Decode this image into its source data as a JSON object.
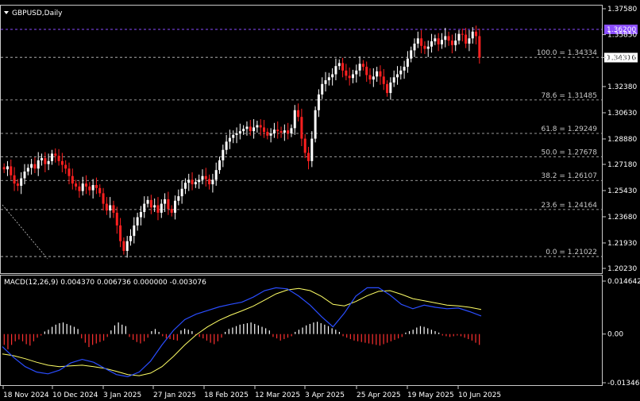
{
  "window": {
    "title": "GBPUSD,Daily",
    "menu_icon": "triangle-down-icon"
  },
  "colors": {
    "background": "#000000",
    "bull": "#ffffff",
    "bear": "#ff2020",
    "fib_line": "#c8c8c8",
    "resistance_line": "#8a4dff",
    "resistance_label_bg": "#8a4dff",
    "macd_line": "#2a4dff",
    "signal_line": "#ffff66",
    "hist_pos": "#ffffff",
    "hist_neg": "#ff3030"
  },
  "chart_data": [
    {
      "type": "candlestick",
      "title": "GBPUSD,Daily",
      "ylim": [
        1.2023,
        1.3758
      ],
      "y_ticks": [
        "1.37580",
        "1.35850",
        "1.34316",
        "1.32380",
        "1.30630",
        "1.28880",
        "1.27180",
        "1.25430",
        "1.23680",
        "1.21930",
        "1.20230"
      ],
      "x_ticks": [
        "18 Nov 2024",
        "10 Dec 2024",
        "3 Jan 2025",
        "27 Jan 2025",
        "18 Feb 2025",
        "12 Mar 2025",
        "3 Apr 2025",
        "25 Apr 2025",
        "19 May 2025",
        "10 Jun 2025"
      ],
      "current_price": "1.34316",
      "resistance": {
        "value": 1.362,
        "label": "1.36200"
      },
      "fib_levels": [
        {
          "value": 1.34334,
          "label": "100.0 = 1.34334"
        },
        {
          "value": 1.31485,
          "label": "78.6 = 1.31485"
        },
        {
          "value": 1.29249,
          "label": "61.8 = 1.29249"
        },
        {
          "value": 1.27678,
          "label": "50.0 = 1.27678"
        },
        {
          "value": 1.26107,
          "label": "38.2 = 1.26107"
        },
        {
          "value": 1.24164,
          "label": "23.6 = 1.24164"
        },
        {
          "value": 1.21022,
          "label": "0.0 = 1.21022"
        }
      ],
      "closes": [
        1.2685,
        1.2705,
        1.2645,
        1.259,
        1.2575,
        1.2625,
        1.267,
        1.2695,
        1.272,
        1.269,
        1.2745,
        1.276,
        1.272,
        1.274,
        1.279,
        1.2775,
        1.274,
        1.2715,
        1.269,
        1.264,
        1.259,
        1.257,
        1.254,
        1.259,
        1.257,
        1.2545,
        1.258,
        1.256,
        1.2525,
        1.2455,
        1.241,
        1.2445,
        1.2395,
        1.231,
        1.2205,
        1.214,
        1.2205,
        1.224,
        1.231,
        1.2365,
        1.24,
        1.2455,
        1.248,
        1.243,
        1.2445,
        1.2395,
        1.2455,
        1.2485,
        1.242,
        1.2395,
        1.2475,
        1.2505,
        1.2555,
        1.2595,
        1.2615,
        1.2585,
        1.26,
        1.2615,
        1.264,
        1.262,
        1.2585,
        1.2615,
        1.268,
        1.2745,
        1.2815,
        1.287,
        1.2895,
        1.2915,
        1.2925,
        1.294,
        1.2955,
        1.297,
        1.294,
        1.2965,
        1.298,
        1.2965,
        1.2935,
        1.291,
        1.2925,
        1.295,
        1.294,
        1.293,
        1.2945,
        1.2925,
        1.296,
        1.308,
        1.3035,
        1.289,
        1.2795,
        1.274,
        1.289,
        1.308,
        1.3185,
        1.3255,
        1.328,
        1.33,
        1.332,
        1.3375,
        1.3395,
        1.3345,
        1.331,
        1.3295,
        1.332,
        1.3345,
        1.339,
        1.337,
        1.3315,
        1.3285,
        1.3305,
        1.334,
        1.3305,
        1.3255,
        1.3195,
        1.3265,
        1.33,
        1.332,
        1.3345,
        1.337,
        1.3425,
        1.348,
        1.3525,
        1.356,
        1.351,
        1.349,
        1.3505,
        1.354,
        1.356,
        1.352,
        1.355,
        1.3575,
        1.3545,
        1.3515,
        1.3545,
        1.359,
        1.3585,
        1.3525,
        1.356,
        1.3605,
        1.3575,
        1.3431
      ],
      "last_close": 1.34316
    },
    {
      "type": "line",
      "title": "MACD(12,26,9) 0.004370 0.006736 0.000000 -0.003076",
      "ylim": [
        -0.013461,
        0.014642
      ],
      "y_ticks": [
        "0.014642",
        "0.00",
        "-0.013461"
      ],
      "series": [
        {
          "name": "MACD",
          "values": [
            -0.0035,
            -0.0065,
            -0.009,
            -0.0105,
            -0.011,
            -0.01,
            -0.008,
            -0.007,
            -0.0078,
            -0.0095,
            -0.0112,
            -0.0118,
            -0.0105,
            -0.0075,
            -0.003,
            0.001,
            0.004,
            0.0055,
            0.0065,
            0.0075,
            0.0082,
            0.0088,
            0.0102,
            0.012,
            0.0128,
            0.0125,
            0.0105,
            0.008,
            0.0048,
            0.002,
            0.0058,
            0.0105,
            0.0128,
            0.0128,
            0.0108,
            0.0082,
            0.007,
            0.008,
            0.0074,
            0.007,
            0.0072,
            0.0062,
            0.005
          ]
        },
        {
          "name": "Signal",
          "values": [
            -0.0055,
            -0.006,
            -0.0068,
            -0.0078,
            -0.0086,
            -0.009,
            -0.0088,
            -0.0086,
            -0.009,
            -0.0095,
            -0.0103,
            -0.0112,
            -0.0115,
            -0.0108,
            -0.009,
            -0.0062,
            -0.003,
            -0.0002,
            0.002,
            0.0038,
            0.0052,
            0.0064,
            0.0077,
            0.0094,
            0.0111,
            0.0122,
            0.0126,
            0.012,
            0.0104,
            0.0082,
            0.0078,
            0.009,
            0.0106,
            0.0118,
            0.012,
            0.011,
            0.0098,
            0.0092,
            0.0086,
            0.008,
            0.0078,
            0.0074,
            0.0068
          ]
        },
        {
          "name": "Histogram",
          "values": [
            -0.003,
            -0.0042,
            -0.003,
            -0.002,
            -0.0015,
            -0.002,
            -0.0028,
            -0.0032,
            -0.002,
            -0.001,
            -0.0004,
            0.0007,
            0.0012,
            0.002,
            0.0026,
            0.003,
            0.0032,
            0.0028,
            0.0024,
            0.002,
            0.0014,
            -0.0012,
            -0.0024,
            -0.0036,
            -0.003,
            -0.0026,
            -0.0022,
            -0.0018,
            -0.0008,
            0.001,
            0.0024,
            0.0032,
            0.0026,
            0.0022,
            -0.0008,
            -0.0016,
            -0.0022,
            -0.0026,
            -0.002,
            -0.001,
            0.0008,
            0.0014,
            0.0006,
            -0.0006,
            -0.0012,
            -0.0014,
            -0.0016,
            -0.0018,
            0.001,
            0.0015,
            0.0012,
            0.0008,
            -0.0004,
            -0.0008,
            -0.0012,
            -0.0018,
            -0.0024,
            -0.0028,
            -0.002,
            -0.001,
            0.0006,
            0.0014,
            0.0018,
            0.0022,
            0.0026,
            0.0028,
            0.003,
            0.0032,
            0.0028,
            0.0024,
            0.002,
            0.0016,
            0.001,
            -0.0008,
            -0.0012,
            -0.0018,
            -0.0014,
            -0.001,
            -0.0006,
            0.0006,
            0.0012,
            0.0018,
            0.0024,
            0.0028,
            0.0032,
            0.0034,
            0.003,
            0.0026,
            0.0022,
            0.0016,
            0.0012,
            0.0006,
            -0.0006,
            -0.001,
            -0.0014,
            -0.0018,
            -0.002,
            -0.0022,
            -0.0024,
            -0.0026,
            -0.0028,
            -0.003,
            -0.0032,
            -0.0028,
            -0.0024,
            -0.002,
            -0.0016,
            -0.0012,
            -0.0008,
            0.0004,
            0.0008,
            0.0012,
            0.0018,
            0.0022,
            0.002,
            0.0016,
            0.0012,
            0.0008,
            0.0004,
            -0.0004,
            -0.0006,
            -0.0008,
            -0.0006,
            -0.0004,
            -0.0006,
            -0.001,
            -0.0014,
            -0.0018,
            -0.0024,
            -0.003
          ]
        }
      ]
    }
  ]
}
